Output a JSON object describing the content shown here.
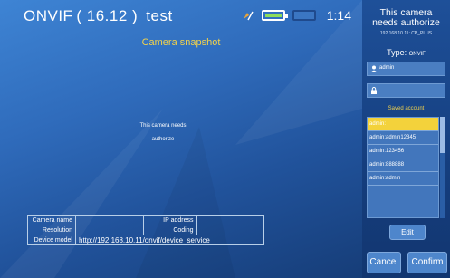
{
  "header": {
    "title": "ONVIF ( 16.12 )  test",
    "time": "1:14"
  },
  "main": {
    "snapshot_title": "Camera snapshot",
    "message_line1": "This camera needs",
    "message_line2": "authorize"
  },
  "info_table": {
    "camera_name_label": "Camera name",
    "camera_name_value": "",
    "ip_address_label": "IP address",
    "ip_address_value": "",
    "resolution_label": "Resolution",
    "resolution_value": "",
    "coding_label": "Coding",
    "coding_value": "",
    "device_model_label": "Device model",
    "device_model_value": "http://192.168.10.11/onvif/device_service"
  },
  "panel": {
    "title_line1": "This camera",
    "title_line2": "needs authorize",
    "device": "192.168.10.11: CP_PLUS",
    "type_label": "Type:",
    "type_value": "ONVIF",
    "username": "admin",
    "password": "",
    "saved_account_label": "Saved account",
    "accounts": [
      "admin:",
      "admin:admin12345",
      "admin:123456",
      "admin:888888",
      "admin:admin"
    ],
    "edit_label": "Edit",
    "cancel_label": "Cancel",
    "confirm_label": "Confirm"
  },
  "colors": {
    "accent_yellow": "#f2d24b",
    "battery_green": "#8fdd5b",
    "panel_blue": "#153e7e"
  },
  "icons": [
    "wifi-icon",
    "battery-icon",
    "user-icon",
    "lock-icon"
  ]
}
